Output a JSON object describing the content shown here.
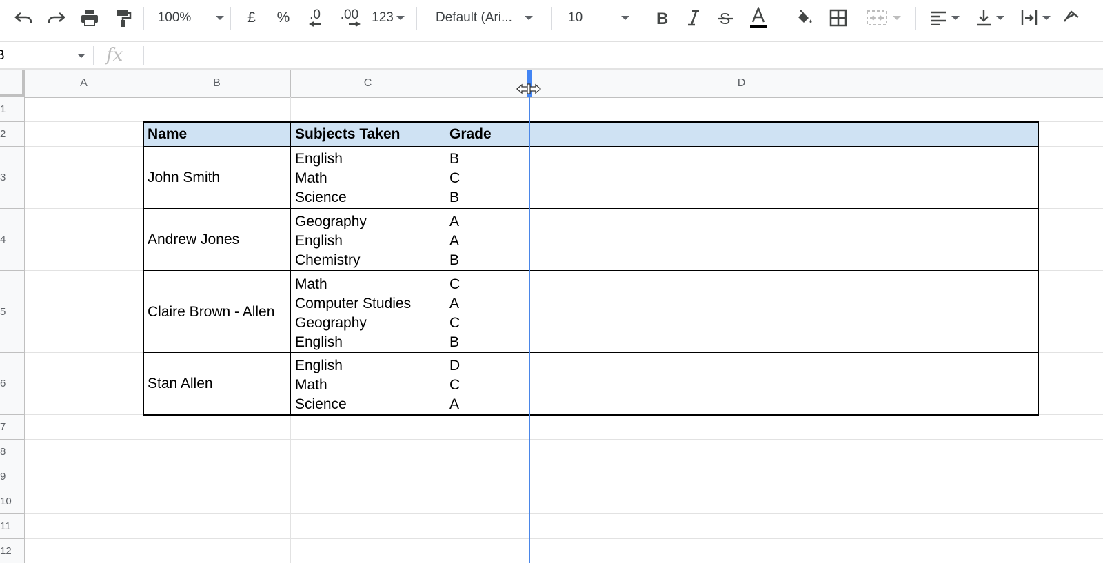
{
  "toolbar": {
    "zoom": "100%",
    "currency": "£",
    "percent": "%",
    "dec_decrease": ".0",
    "dec_increase": ".00",
    "number_format": "123",
    "font": "Default (Ari...",
    "font_size": "10"
  },
  "formula_bar": {
    "cell_ref": "B",
    "fx": "fx",
    "value": ""
  },
  "columns": [
    "A",
    "B",
    "C",
    "D"
  ],
  "rows": [
    "1",
    "2",
    "3",
    "4",
    "5",
    "6",
    "7",
    "8",
    "9",
    "10",
    "11",
    "12"
  ],
  "table": {
    "headers": {
      "name": "Name",
      "subjects": "Subjects Taken",
      "grade": "Grade"
    },
    "students": [
      {
        "name": "John Smith",
        "subjects": [
          "English",
          "Math",
          "Science"
        ],
        "grades": [
          "B",
          "C",
          "B"
        ]
      },
      {
        "name": "Andrew Jones",
        "subjects": [
          "Geography",
          "English",
          "Chemistry"
        ],
        "grades": [
          "A",
          "A",
          "B"
        ]
      },
      {
        "name": "Claire Brown - Allen",
        "subjects": [
          "Math",
          "Computer Studies",
          "Geography",
          "English"
        ],
        "grades": [
          "C",
          "A",
          "C",
          "B"
        ]
      },
      {
        "name": "Stan Allen",
        "subjects": [
          "English",
          "Math",
          "Science"
        ],
        "grades": [
          "D",
          "C",
          "A"
        ]
      }
    ]
  },
  "colors": {
    "header_fill": "#cfe2f3",
    "resize_handle": "#4285f4"
  }
}
